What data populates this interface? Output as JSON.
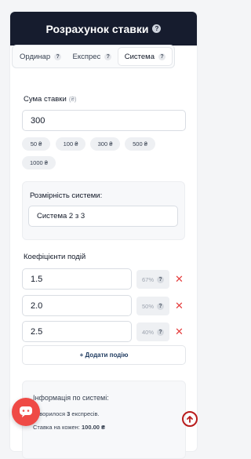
{
  "header": {
    "title": "Розрахунок ставки",
    "help": "?"
  },
  "tabs": [
    {
      "label": "Ординар",
      "help": "?"
    },
    {
      "label": "Експрес",
      "help": "?"
    },
    {
      "label": "Система",
      "help": "?",
      "active": true
    }
  ],
  "stake": {
    "label": "Сума ставки",
    "currency": "(₴)",
    "value": "300",
    "quick_amounts": [
      "50 ₴",
      "100 ₴",
      "300 ₴",
      "500 ₴",
      "1000 ₴"
    ]
  },
  "system": {
    "label": "Розмірність системи:",
    "value": "Система 2 з 3"
  },
  "odds": {
    "label": "Коефіцієнти подій",
    "items": [
      {
        "value": "1.5",
        "probability": "67%",
        "help": "?"
      },
      {
        "value": "2.0",
        "probability": "50%",
        "help": "?"
      },
      {
        "value": "2.5",
        "probability": "40%",
        "help": "?"
      }
    ],
    "remove_symbol": "✕",
    "add_label": "+ Додати подію"
  },
  "info": {
    "title": "Інформація по системі:",
    "line1_prefix": "Утворилося ",
    "line1_count": "3",
    "line1_suffix": " експресів.",
    "line2_prefix": "Ставка на кожен: ",
    "line2_value": "100.00 ₴"
  },
  "colors": {
    "header_bg": "#161c2e",
    "remove": "#e53e3e",
    "chat_button": "#ef4a45",
    "scroll_top": "#b91c1c"
  },
  "icons": {
    "chat": "chat-icon",
    "scroll_top": "arrow-up-icon"
  }
}
